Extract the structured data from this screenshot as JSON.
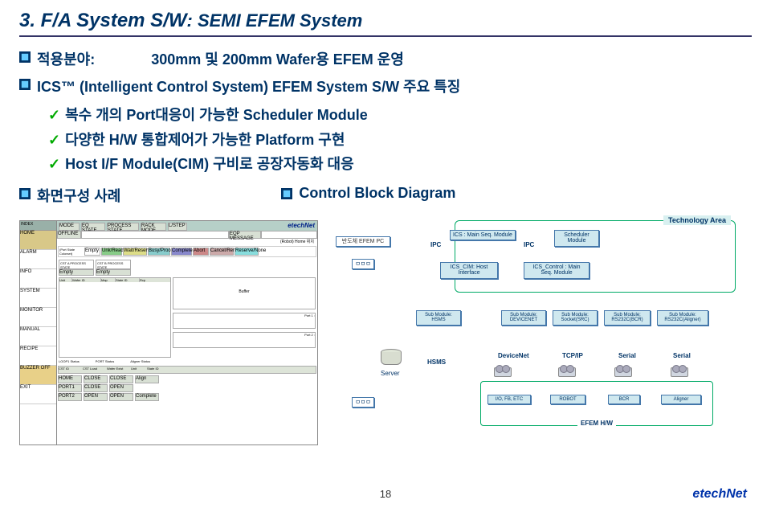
{
  "title": {
    "prefix": "3. F/A System S/W",
    "suffix": ": SEMI EFEM System"
  },
  "section1": {
    "label": "적용분야:",
    "value": "300mm 및 200mm Wafer용 EFEM 운영"
  },
  "section2": {
    "heading": "ICS™ (Intelligent Control System) EFEM System S/W 주요 특징",
    "items": [
      "복수 개의 Port대응이 가능한 Scheduler Module",
      "다양한 H/W 통합제어가 가능한 Platform 구현",
      "Host I/F Module(CIM) 구비로 공장자동화 대응"
    ]
  },
  "section3": {
    "label": "화면구성 사례"
  },
  "section4": {
    "label": "Control Block Diagram"
  },
  "diagram": {
    "tech_area": "Technology Area",
    "efem_pc": "반도체 EFEM PC",
    "box1": "ㅁㅁㅁ",
    "ics": "ICS :\nMain Seq. Module",
    "ipc1": "IPC",
    "ipc2": "IPC",
    "scheduler": "Scheduler\nModule",
    "ics_cim": "ICS_CIM:\nHost Interface",
    "ics_control": "ICS_Control :\nMain Seq. Module",
    "sub_hsms": "Sub Module:\nHSMS",
    "sub_devicenet": "Sub Module:\nDEVICENET",
    "sub_socket": "Sub Module:\nSocket(SRC)",
    "sub_rs_bcr": "Sub Module:\nRS232C(BCR)",
    "sub_rs_aligner": "Sub Module:\nRS232C(Aligner)",
    "server": "Server",
    "hsms": "HSMS",
    "devicenet": "DeviceNet",
    "tcpip": "TCP/IP",
    "serial1": "Serial",
    "serial2": "Serial",
    "io": "I/O, FB, ETC",
    "robot": "ROBOT",
    "bcr": "BCR",
    "aligner": "Aligner",
    "efem_hw": "EFEM H/W",
    "box2": "ㅁㅁㅁ"
  },
  "screenshot": {
    "brand": "etechNet",
    "nav": [
      "HOME",
      "ALARM",
      "INFO",
      "SYSTEM",
      "MONITOR",
      "MANUAL",
      "RECIPE",
      "BUZZER OFF",
      "EXIT"
    ],
    "top_btns": [
      "MODE",
      "EQ STATE",
      "PROCESS STATE",
      "RACK MODE",
      "L/STEP"
    ],
    "msg_row": [
      "OFFLINE",
      "",
      "",
      "",
      "",
      "EQP MESSAGE"
    ],
    "robot_label": "(Robot) Home 위치",
    "state_btns": [
      "Empty",
      "Unk/Ready",
      "Wait/Reserve",
      "Busy/Processing",
      "Complete",
      "Abort",
      "Cancel/Remove",
      "Reserve/None"
    ],
    "cst_headers": [
      "CST A PROCESS STATE",
      "CST TYPE",
      "CST B PROCESS STATE",
      "CST TYPE"
    ],
    "cst_empty": "Empty",
    "grid_headers": [
      "Unit",
      "Wafer ID",
      "Map",
      "State ID",
      "Rcp"
    ],
    "buffer": "Buffer",
    "ports": [
      "Port 1 :",
      "Port 2 :"
    ],
    "bottom_labels": [
      "LOOP1 Status",
      "PORT Status",
      "Aligner Status"
    ],
    "grid2_headers": [
      "CST ID",
      "CST Load",
      "Wafer Exist",
      "Unit",
      "State ID",
      "Port 1",
      "Port 2"
    ],
    "bottom_btns": [
      [
        "HOME",
        "CLOSE",
        "CLOSE",
        "Align"
      ],
      [
        "PORT1",
        "CLOSE",
        "OPEN",
        ""
      ],
      [
        "PORT2",
        "OPEN",
        "OPEN",
        "Complete"
      ]
    ]
  },
  "footer": {
    "page": "18",
    "brand": "etechNet"
  }
}
